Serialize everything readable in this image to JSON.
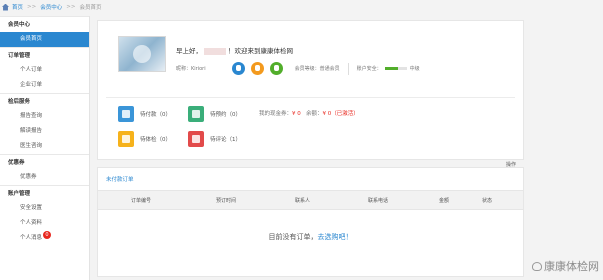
{
  "breadcrumb": {
    "home": "首页",
    "sep": ">>",
    "member_center": "会员中心",
    "current": "会员首页"
  },
  "sidebar": {
    "groups": [
      {
        "title": "会员中心",
        "items": [
          {
            "label": "会员首页",
            "active": true
          }
        ]
      },
      {
        "title": "订单管理",
        "items": [
          {
            "label": "个人订单"
          },
          {
            "label": "企业订单"
          }
        ]
      },
      {
        "title": "检后服务",
        "items": [
          {
            "label": "报告查询"
          },
          {
            "label": "解读报告"
          },
          {
            "label": "医生咨询"
          }
        ]
      },
      {
        "title": "优惠券",
        "items": [
          {
            "label": "优惠券"
          }
        ]
      },
      {
        "title": "账户管理",
        "items": [
          {
            "label": "安全设置"
          },
          {
            "label": "个人资料"
          },
          {
            "label": "个人消息",
            "badge": "0"
          }
        ]
      }
    ]
  },
  "profile": {
    "greeting_prefix": "早上好，",
    "greeting_suffix": "！欢迎来到康康体检网",
    "nickname_label": "昵称：Kiriori",
    "level_label": "会员等级：",
    "level_value": "普通会员",
    "security_label": "账户安全：",
    "security_value": "中级",
    "security_level": 0.6
  },
  "stats": {
    "unpaid": "待付款（0）",
    "to_book": "待预约（0）",
    "balance_label": "我的现金券：",
    "balance_value": "¥ 0",
    "remain_label": "余额：",
    "remain_value": "¥ 0（已激活）",
    "to_check": "待体检（0）",
    "to_review": "待评论（1）"
  },
  "orders": {
    "title": "未付款订单",
    "columns": [
      "订单编号",
      "预订时间",
      "联系人",
      "联系电话",
      "金额",
      "状态",
      "操作"
    ],
    "empty_text": "目前没有订单，",
    "empty_link": "去选购吧！"
  },
  "watermark": "康康体检网",
  "colors": {
    "accent": "#2a87d0",
    "active_bg": "#2a87d0",
    "price_red": "#e8281f"
  }
}
